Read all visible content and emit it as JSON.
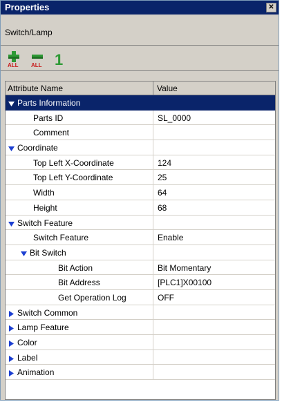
{
  "window": {
    "title": "Properties",
    "subtitle": "Switch/Lamp"
  },
  "toolbar": {
    "expand_all_label": "ALL",
    "collapse_all_label": "ALL",
    "number_label": "1"
  },
  "grid": {
    "headers": {
      "name": "Attribute Name",
      "value": "Value"
    },
    "rows": [
      {
        "name": "Parts Information",
        "value": "",
        "level": 0,
        "group": true,
        "expanded": true,
        "selected": true
      },
      {
        "name": "Parts ID",
        "value": "SL_0000",
        "level": 1
      },
      {
        "name": "Comment",
        "value": "",
        "level": 1
      },
      {
        "name": "Coordinate",
        "value": "",
        "level": 0,
        "group": true,
        "expanded": true
      },
      {
        "name": "Top Left X-Coordinate",
        "value": "124",
        "level": 1
      },
      {
        "name": "Top Left Y-Coordinate",
        "value": "25",
        "level": 1
      },
      {
        "name": "Width",
        "value": "64",
        "level": 1
      },
      {
        "name": "Height",
        "value": "68",
        "level": 1
      },
      {
        "name": "Switch Feature",
        "value": "",
        "level": 0,
        "group": true,
        "expanded": true
      },
      {
        "name": "Switch Feature",
        "value": "Enable",
        "level": 1
      },
      {
        "name": "Bit Switch",
        "value": "",
        "level": 1,
        "group": true,
        "expanded": true
      },
      {
        "name": "Bit Action",
        "value": "Bit Momentary",
        "level": 2
      },
      {
        "name": "Bit Address",
        "value": "[PLC1]X00100",
        "level": 2
      },
      {
        "name": "Get Operation Log",
        "value": "OFF",
        "level": 2
      },
      {
        "name": "Switch Common",
        "value": "",
        "level": 0,
        "group": true,
        "expanded": false
      },
      {
        "name": "Lamp Feature",
        "value": "",
        "level": 0,
        "group": true,
        "expanded": false
      },
      {
        "name": "Color",
        "value": "",
        "level": 0,
        "group": true,
        "expanded": false
      },
      {
        "name": "Label",
        "value": "",
        "level": 0,
        "group": true,
        "expanded": false
      },
      {
        "name": "Animation",
        "value": "",
        "level": 0,
        "group": true,
        "expanded": false
      }
    ]
  },
  "colors": {
    "selection": "#0a246a",
    "arrow": "#1c3fd1",
    "toolbar_green": "#2e9a35",
    "toolbar_red": "#c81b1b"
  }
}
